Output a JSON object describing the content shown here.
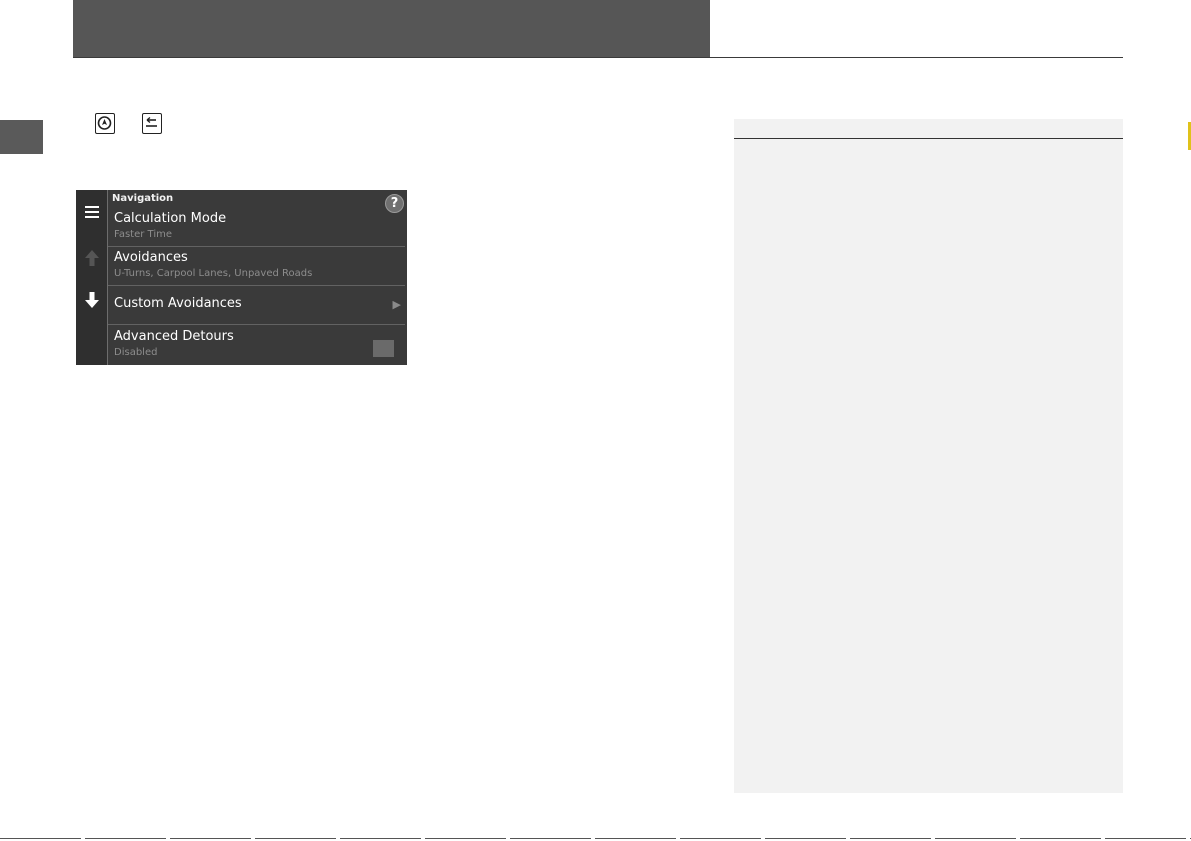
{
  "page": {
    "header": {
      "title": ""
    },
    "side_tab": {
      "label": ""
    }
  },
  "buttons": {
    "nav_button_icon": "navigation-button-icon",
    "back_button_icon": "back-button-icon"
  },
  "screen": {
    "title": "Navigation",
    "help_label": "?",
    "rows": [
      {
        "label": "Calculation Mode",
        "sub": "Faster Time"
      },
      {
        "label": "Avoidances",
        "sub": "U-Turns, Carpool Lanes, Unpaved Roads"
      },
      {
        "label": "Custom Avoidances",
        "sub": ""
      },
      {
        "label": "Advanced Detours",
        "sub": "Disabled"
      }
    ],
    "colors": {
      "background": "#3a3a3a",
      "rail": "#2f2f2f",
      "subtext": "#8d8d8d"
    }
  },
  "note_panel": {
    "title": ""
  }
}
